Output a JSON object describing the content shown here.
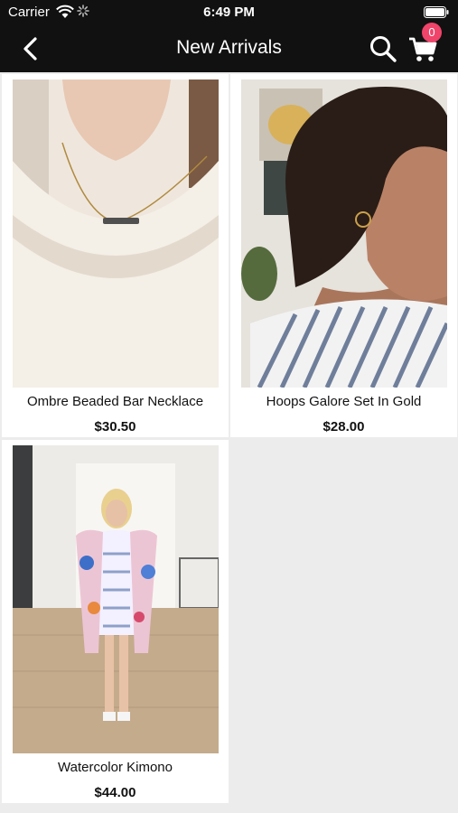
{
  "status": {
    "carrier": "Carrier",
    "time": "6:49 PM"
  },
  "nav": {
    "title": "New Arrivals",
    "cart_count": "0"
  },
  "products": [
    {
      "name": "Ombre Beaded Bar Necklace",
      "price": "$30.50"
    },
    {
      "name": "Hoops Galore Set In Gold",
      "price": "$28.00"
    },
    {
      "name": "Watercolor Kimono",
      "price": "$44.00"
    }
  ],
  "colors": {
    "bar": "#111111",
    "badge": "#f0446b",
    "background": "#ececec"
  }
}
